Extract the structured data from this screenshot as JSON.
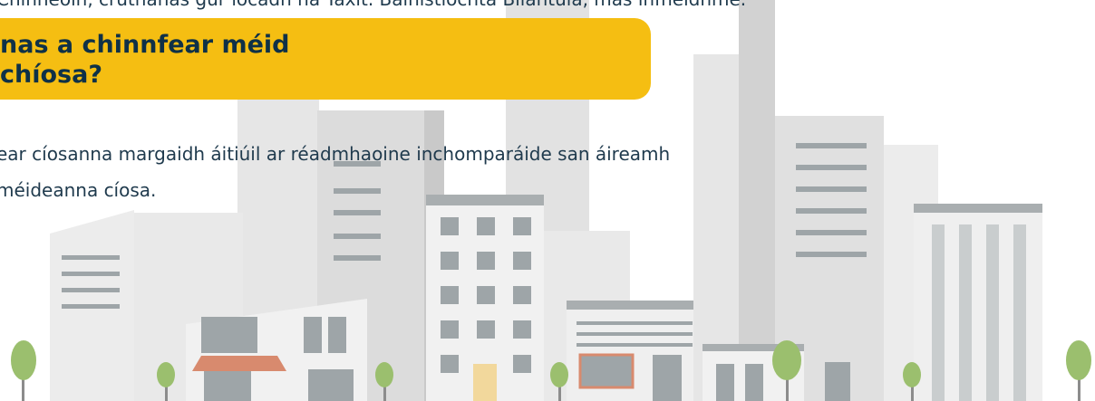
{
  "intro_line": "Chinneoin, cruthanas gur íocadh na Taxit. Bainistíochta Bliantúla, mas infheidhme.",
  "banner": {
    "title": "nas a chinnfear méid\nchíosa?",
    "color": "#f5be12"
  },
  "body": {
    "text": "ear cíosanna margaidh áitiúil ar réadmhaoine inchomparáide san áireamh\nméideanna cíosa."
  },
  "illustration": {
    "subject": "city-skyline",
    "palette": {
      "building_light": "#ececec",
      "building_mid": "#dcdcdc",
      "window": "#9ea5a8",
      "awning": "#d88a6e",
      "tree": "#9bbf6e",
      "trunk": "#8c8c8c",
      "door": "#f2d89c"
    }
  }
}
